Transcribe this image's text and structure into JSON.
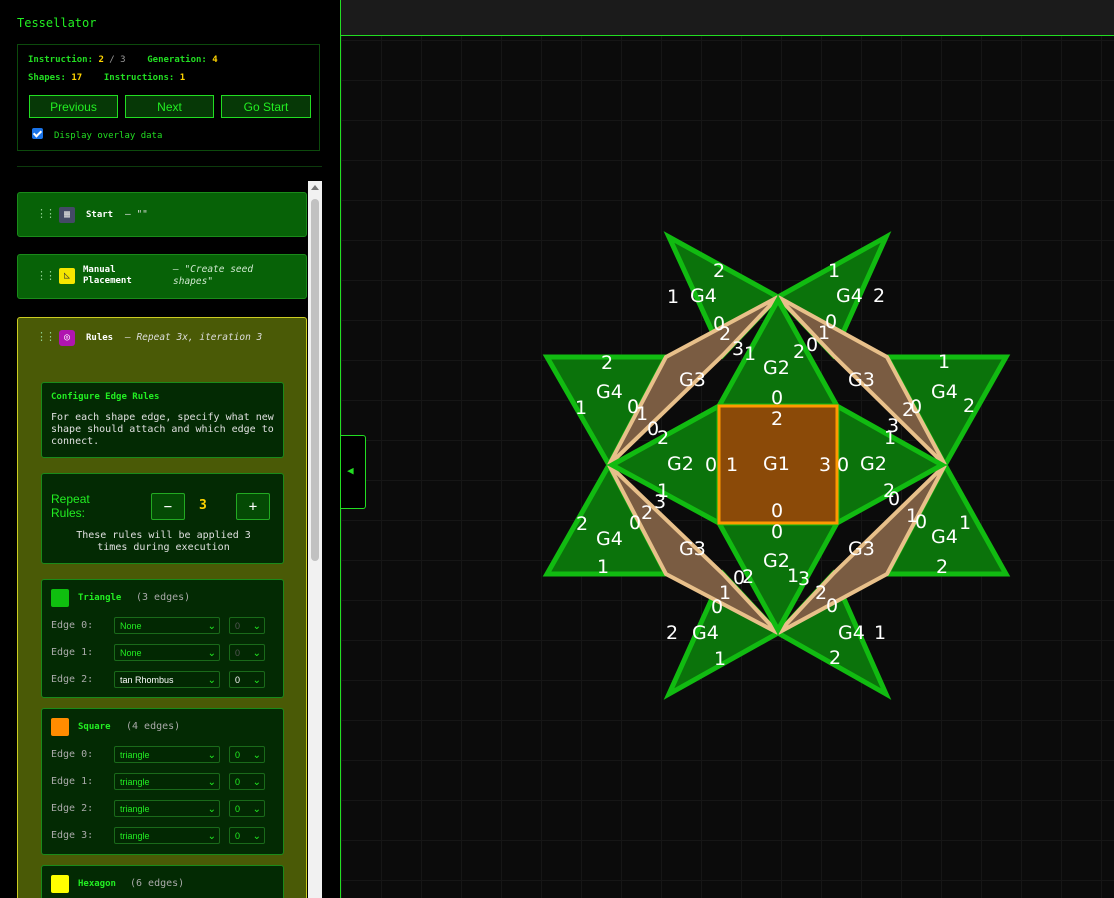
{
  "app": {
    "title": "Tessellator"
  },
  "status": {
    "instruction_label": "Instruction:",
    "instruction_current": "2",
    "instruction_sep": "/",
    "instruction_total": "3",
    "generation_label": "Generation:",
    "generation_value": "4",
    "shapes_label": "Shapes:",
    "shapes_value": "17",
    "instructions_label": "Instructions:",
    "instructions_value": "1"
  },
  "nav": {
    "previous": "Previous",
    "next": "Next",
    "go_start": "Go Start"
  },
  "overlay": {
    "label": "Display overlay data",
    "checked": true
  },
  "instructions": [
    {
      "name": "Start",
      "desc": "— \"\"",
      "icon": "clapper-icon"
    },
    {
      "name_line1": "Manual",
      "name_line2": "Placement",
      "desc_line1": "— \"Create seed",
      "desc_line2": "shapes\"",
      "icon": "ruler-triangle-icon"
    },
    {
      "name": "Rules",
      "desc": "— Repeat 3x, iteration 3",
      "icon": "target-icon"
    }
  ],
  "rules": {
    "config_title": "Configure Edge Rules",
    "config_text": "For each shape edge, specify what new shape should attach and which edge to connect.",
    "repeat_label_line1": "Repeat",
    "repeat_label_line2": "Rules:",
    "minus": "−",
    "plus": "+",
    "repeat_value": "3",
    "repeat_note_line1": "These rules will be applied 3",
    "repeat_note_line2": "times during execution",
    "shapes": [
      {
        "name": "Triangle",
        "edges_label": "(3 edges)",
        "color": "#0fbf0f",
        "edges": [
          {
            "label": "Edge 0:",
            "shape": "None",
            "edge": "0"
          },
          {
            "label": "Edge 1:",
            "shape": "None",
            "edge": "0"
          },
          {
            "label": "Edge 2:",
            "shape": "tan Rhombus",
            "edge": "0"
          }
        ]
      },
      {
        "name": "Square",
        "edges_label": "(4 edges)",
        "color": "#ff8c00",
        "edges": [
          {
            "label": "Edge 0:",
            "shape": "triangle",
            "edge": "0"
          },
          {
            "label": "Edge 1:",
            "shape": "triangle",
            "edge": "0"
          },
          {
            "label": "Edge 2:",
            "shape": "triangle",
            "edge": "0"
          },
          {
            "label": "Edge 3:",
            "shape": "triangle",
            "edge": "0"
          }
        ]
      },
      {
        "name": "Hexagon",
        "edges_label": "(6 edges)",
        "color": "#ffff00"
      }
    ]
  },
  "canvas": {
    "colors": {
      "triangle_fill": "#0b730b",
      "triangle_stroke": "#11bb11",
      "rhombus_fill": "#7a5c42",
      "rhombus_stroke": "#e8c08a",
      "square_fill": "#8b4a08",
      "square_stroke": "#ff9900",
      "label": "#ffffff"
    },
    "shapes_labels": {
      "square": "G1",
      "gen2": [
        "G2",
        "G2",
        "G2",
        "G2"
      ],
      "gen3": [
        "G3",
        "G3",
        "G3",
        "G3"
      ],
      "gen4": [
        "G4",
        "G4",
        "G4",
        "G4",
        "G4",
        "G4",
        "G4",
        "G4"
      ]
    },
    "collapse_icon": "chevron-left-icon"
  }
}
